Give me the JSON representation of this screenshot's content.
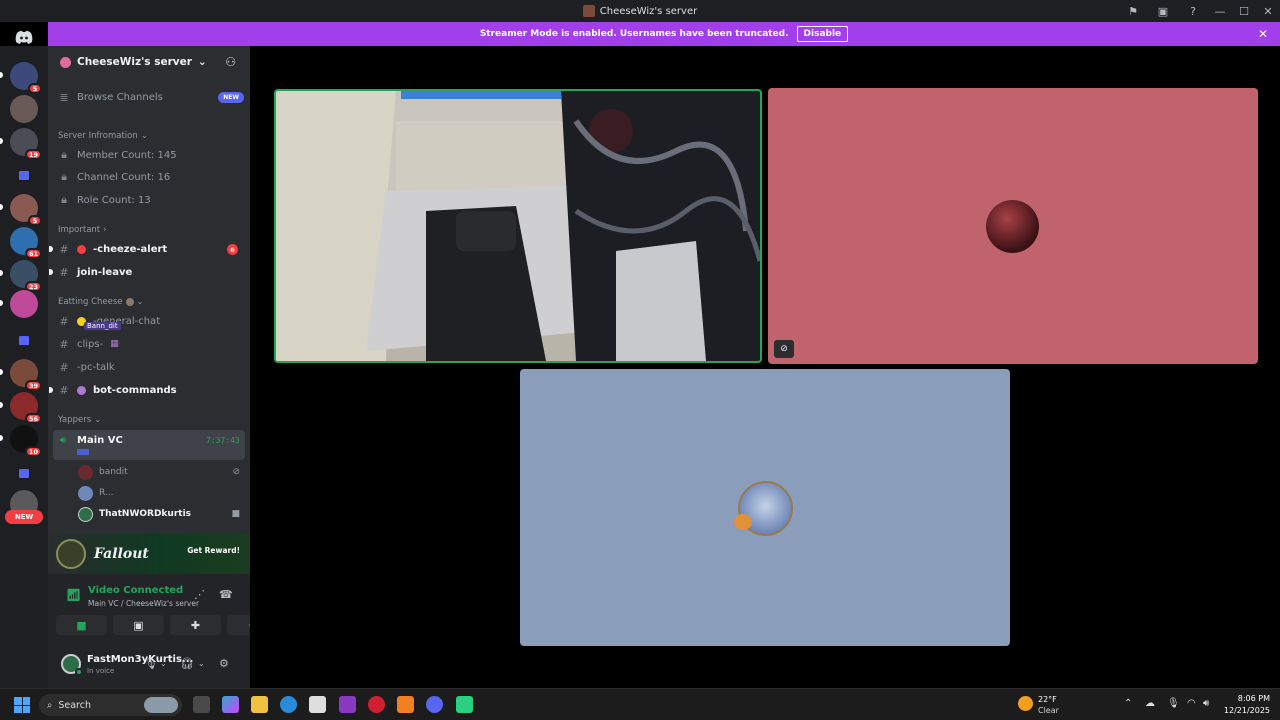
{
  "window": {
    "title": "CheeseWiz's server"
  },
  "banner": {
    "text": "Streamer Mode is enabled. Usernames have been truncated.",
    "button": "Disable"
  },
  "servers": [
    {
      "badge": "5",
      "color": "#3b4a7a"
    },
    {
      "badge": "",
      "color": "#6a5a55"
    },
    {
      "badge": "19",
      "color": "#4a4d55"
    },
    {
      "badge": "",
      "folder": true
    },
    {
      "badge": "5",
      "color": "#8a5a52"
    },
    {
      "badge": "61",
      "color": "#2f6fb0"
    },
    {
      "badge": "23",
      "color": "#3a4e66"
    },
    {
      "badge": "",
      "color": "#c04a9a"
    },
    {
      "badge": "",
      "folder": true
    },
    {
      "badge": "39",
      "color": "#7a4a3a"
    },
    {
      "badge": "56",
      "color": "#8a2a2a"
    },
    {
      "badge": "10",
      "color": "#111111"
    },
    {
      "badge": "",
      "folder": true
    },
    {
      "badge": "",
      "color": "#5a5a5a"
    }
  ],
  "servers_new_label": "NEW",
  "sidebar": {
    "server_name": "CheeseWiz's server",
    "browse": "Browse Channels",
    "browse_tag": "NEW",
    "cat_info": "Server Infromation",
    "member_count": "Member Count: 145",
    "channel_count": "Channel Count: 16",
    "role_count": "Role Count: 13",
    "cat_important": "Important",
    "ch_alert": "-cheeze-alert",
    "ch_alert_mentions": "6",
    "ch_joinleave": "join-leave",
    "cat_eating": "Eatting Cheese",
    "ch_general": "-general-chat",
    "ch_general_typer": "Bann_dit",
    "ch_clips": "clips-",
    "ch_pctalk": "-pc-talk",
    "ch_bot": "bot-commands",
    "cat_yappers": "Yappers",
    "vc_name": "Main VC",
    "vc_time": "7:37:43",
    "vc_users": [
      {
        "name": "bandit",
        "color": "#6a2a2e",
        "icon": "muted-icon"
      },
      {
        "name": "R...",
        "color": "#6f88b8",
        "icon": ""
      },
      {
        "name": "ThatNWORDkurtis",
        "color": "#2e6d4a",
        "icon": "video-icon"
      }
    ]
  },
  "promo": {
    "brand": "Fallout",
    "button": "Get Reward!"
  },
  "voice": {
    "status": "Video Connected",
    "location": "Main VC / CheeseWiz's server"
  },
  "user": {
    "name": "FastMon3yKurtis...",
    "status": "In voice"
  },
  "taskbar": {
    "search_placeholder": "Search",
    "weather_temp": "22°F",
    "weather_cond": "Clear",
    "time": "8:06 PM",
    "date": "12/21/2025"
  },
  "colors": {
    "accent": "#5865f2",
    "streamer_banner": "#a23fea",
    "online": "#23a55a",
    "danger": "#f23f43"
  }
}
